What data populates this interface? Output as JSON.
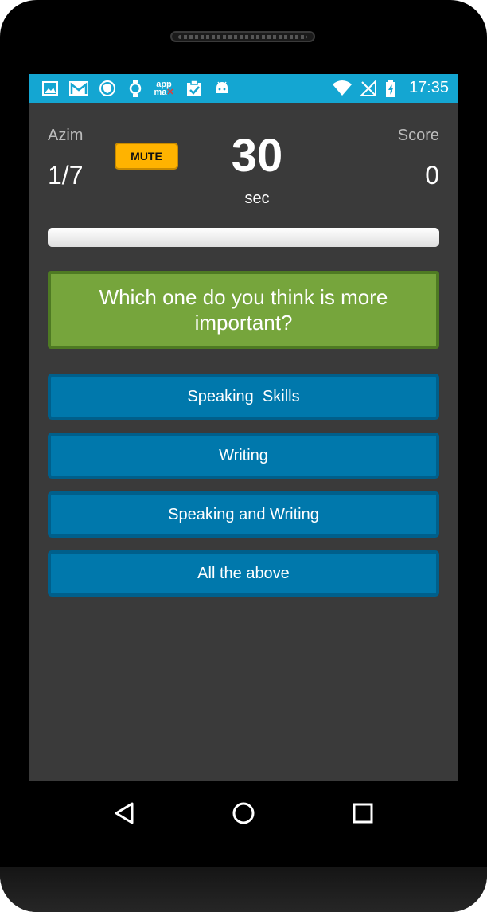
{
  "status_bar": {
    "time": "17:35",
    "left_icons": [
      "image-icon",
      "gmail-icon",
      "vpn-shield-icon",
      "watch-icon",
      "appmax-icon",
      "clipboard-check-icon",
      "android-icon"
    ],
    "right_icons": [
      "wifi-icon",
      "no-signal-icon",
      "battery-charging-icon"
    ],
    "appmax_text_top": "app",
    "appmax_text_bottom": "ma"
  },
  "header": {
    "player_name": "Azim",
    "progress": "1/7",
    "mute_label": "MUTE",
    "timer_value": "30",
    "timer_unit": "sec",
    "score_label": "Score",
    "score_value": "0"
  },
  "timer_bar": {
    "fill_fraction": 1.0
  },
  "question": {
    "text": "Which one do you think is more important?"
  },
  "answers": [
    {
      "label": "Speaking  Skills"
    },
    {
      "label": "Writing"
    },
    {
      "label": "Speaking and Writing"
    },
    {
      "label": "All the above"
    }
  ],
  "nav_bar": {
    "icons": [
      "back-icon",
      "home-icon",
      "recents-icon"
    ]
  },
  "colors": {
    "status_bar": "#14a6d2",
    "background": "#3a3a3a",
    "mute_button": "#ffb300",
    "question_box": "#76a53c",
    "answer_button": "#0078ac"
  }
}
